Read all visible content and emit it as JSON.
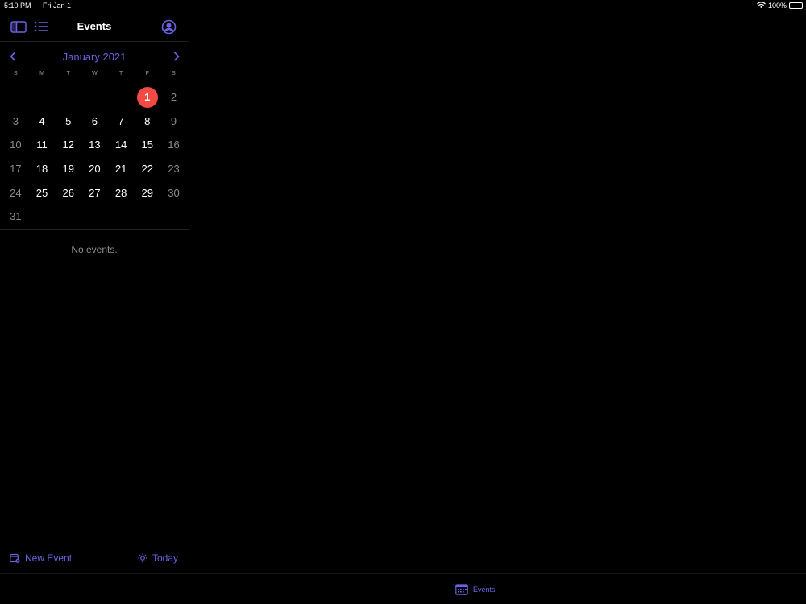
{
  "status_bar": {
    "time": "5:10 PM",
    "date": "Fri Jan 1",
    "battery": "100%",
    "battery_level": 1.0
  },
  "nav": {
    "title": "Events",
    "left_icons": [
      "sidebar-toggle-icon",
      "list-icon"
    ],
    "right_icon": "account-icon"
  },
  "calendar": {
    "month_label": "January 2021",
    "weekdays": [
      "S",
      "M",
      "T",
      "W",
      "T",
      "F",
      "S"
    ],
    "days": [
      "",
      "",
      "",
      "",
      "",
      "1",
      "2",
      "3",
      "4",
      "5",
      "6",
      "7",
      "8",
      "9",
      "10",
      "11",
      "12",
      "13",
      "14",
      "15",
      "16",
      "17",
      "18",
      "19",
      "20",
      "21",
      "22",
      "23",
      "24",
      "25",
      "26",
      "27",
      "28",
      "29",
      "30",
      "31"
    ],
    "selected_day": "1"
  },
  "events": {
    "empty_text": "No events."
  },
  "toolbar": {
    "new_event": "New Event",
    "today": "Today"
  },
  "tabbar": {
    "events_label": "Events"
  },
  "colors": {
    "accent": "#6b62e0",
    "today": "#f24a44",
    "background": "#000000"
  }
}
